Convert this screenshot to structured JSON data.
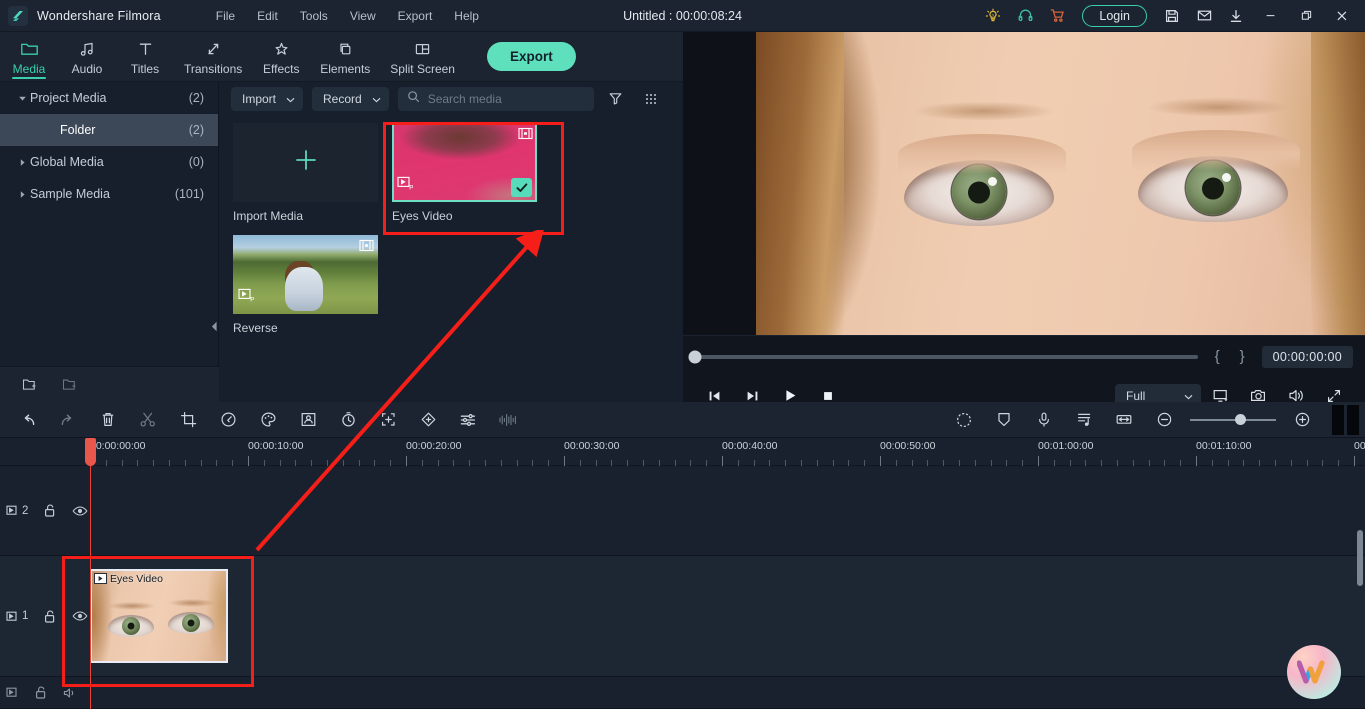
{
  "titlebar": {
    "app_name": "Wondershare Filmora",
    "doc_title": "Untitled : 00:00:08:24",
    "menus": [
      "File",
      "Edit",
      "Tools",
      "View",
      "Export",
      "Help"
    ],
    "login_label": "Login",
    "icons": [
      "bulb-icon",
      "headset-icon",
      "cart-icon",
      "save-icon",
      "mail-icon",
      "download-icon"
    ],
    "window_controls": [
      "minimize-icon",
      "restore-icon",
      "close-icon"
    ]
  },
  "ribbon": {
    "tabs": [
      {
        "label": "Media",
        "icon": "folder-icon",
        "active": true
      },
      {
        "label": "Audio",
        "icon": "music-note-icon",
        "active": false
      },
      {
        "label": "Titles",
        "icon": "text-t-icon",
        "active": false
      },
      {
        "label": "Transitions",
        "icon": "transition-arrows-icon",
        "active": false
      },
      {
        "label": "Effects",
        "icon": "sparkle-star-icon",
        "active": false
      },
      {
        "label": "Elements",
        "icon": "layers-icon",
        "active": false
      },
      {
        "label": "Split Screen",
        "icon": "split-screen-icon",
        "active": false
      }
    ],
    "export_label": "Export"
  },
  "library_tree": {
    "rows": [
      {
        "label": "Project Media",
        "count": "(2)",
        "caret": "caret-down",
        "indent": 0,
        "selected": false
      },
      {
        "label": "Folder",
        "count": "(2)",
        "caret": "none",
        "indent": 1,
        "selected": true
      },
      {
        "label": "Global Media",
        "count": "(0)",
        "caret": "caret-right",
        "indent": 0,
        "selected": false
      },
      {
        "label": "Sample Media",
        "count": "(101)",
        "caret": "caret-right",
        "indent": 0,
        "selected": false
      }
    ],
    "footer_icons": [
      "new-folder-icon",
      "remove-folder-icon"
    ]
  },
  "media_browser": {
    "import_button": "Import",
    "record_button": "Record",
    "search_placeholder": "Search media",
    "search_value": "",
    "filter_icon": "filter-icon",
    "grid_view_icon": "grid-view-icon",
    "items": [
      {
        "label": "Import Media",
        "kind": "import-placeholder",
        "selected": false
      },
      {
        "label": "Eyes Video",
        "kind": "video",
        "selected": true
      },
      {
        "label": "Reverse",
        "kind": "video",
        "selected": false
      }
    ]
  },
  "preview": {
    "timecode": "00:00:00:00",
    "mark_in": "{",
    "mark_out": "}",
    "quality": "Full",
    "playhead_percent": 0,
    "controls": [
      "prev-frame-icon",
      "next-frame-icon",
      "play-icon",
      "stop-icon"
    ],
    "right_controls": [
      "display-settings-icon",
      "snapshot-icon",
      "volume-icon",
      "fullscreen-icon"
    ]
  },
  "timeline_toolbar": {
    "left_icons": [
      "undo-icon",
      "redo-icon",
      "delete-icon",
      "split-scissors-icon",
      "crop-icon",
      "speed-icon",
      "color-icon",
      "green-screen-icon",
      "duration-icon",
      "crop-zoom-icon",
      "keyframe-icon",
      "adjust-sliders-icon",
      "audio-waveform-icon"
    ],
    "right_icons": [
      "motion-tracking-icon",
      "mask-icon",
      "voiceover-icon",
      "audio-mixer-icon",
      "fit-timeline-icon",
      "zoom-out-icon",
      "zoom-in-icon"
    ],
    "zoom_value_percent": 52
  },
  "timeline": {
    "ruler_labels": [
      "00:00:00:00",
      "00:00:10:00",
      "00:00:20:00",
      "00:00:30:00",
      "00:00:40:00",
      "00:00:50:00",
      "00:01:00:00",
      "00:01:10:00"
    ],
    "tracks": [
      {
        "number": "2",
        "lock_icon": "unlock-icon",
        "eye_icon": "eye-icon",
        "clips": []
      },
      {
        "number": "1",
        "lock_icon": "unlock-icon",
        "eye_icon": "eye-icon",
        "clips": [
          {
            "label": "Eyes Video",
            "icon": "play-icon"
          }
        ]
      }
    ],
    "playhead_time": "00:00:00:00"
  },
  "annotations": {
    "highlight_media_item": "Eyes Video",
    "highlight_timeline_clip": "Eyes Video",
    "arrow_color": "#f61e18"
  },
  "branding": {
    "watermark": "wondershare-w-logo"
  }
}
